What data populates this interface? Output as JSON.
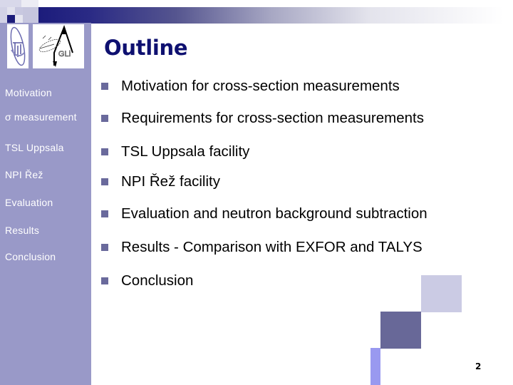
{
  "slide": {
    "title": "Outline",
    "page_number": "2"
  },
  "sidebar": {
    "items": [
      {
        "label": "Motivation"
      },
      {
        "label": "σ measurement"
      },
      {
        "label": "TSL Uppsala"
      },
      {
        "label": "NPI Řež"
      },
      {
        "label": "Evaluation"
      },
      {
        "label": "Results"
      },
      {
        "label": "Conclusion"
      }
    ],
    "logos": [
      {
        "name": "institute-logo"
      },
      {
        "name": "gli-logo",
        "text": "GLi"
      }
    ]
  },
  "bullets": [
    {
      "text": "Motivation for cross-section measurements"
    },
    {
      "text": "Requirements for cross-section measurements"
    },
    {
      "text": "TSL Uppsala facility"
    },
    {
      "text": "NPI Řež facility"
    },
    {
      "text": "Evaluation and neutron background subtraction"
    },
    {
      "text": "Results - Comparison with EXFOR and TALYS"
    },
    {
      "text": "Conclusion"
    }
  ],
  "colors": {
    "title": "#0e1070",
    "sidebar": "#9999c8",
    "bullet_mark": "#6a6a9c",
    "bar_dark": "#1a1a7a"
  }
}
